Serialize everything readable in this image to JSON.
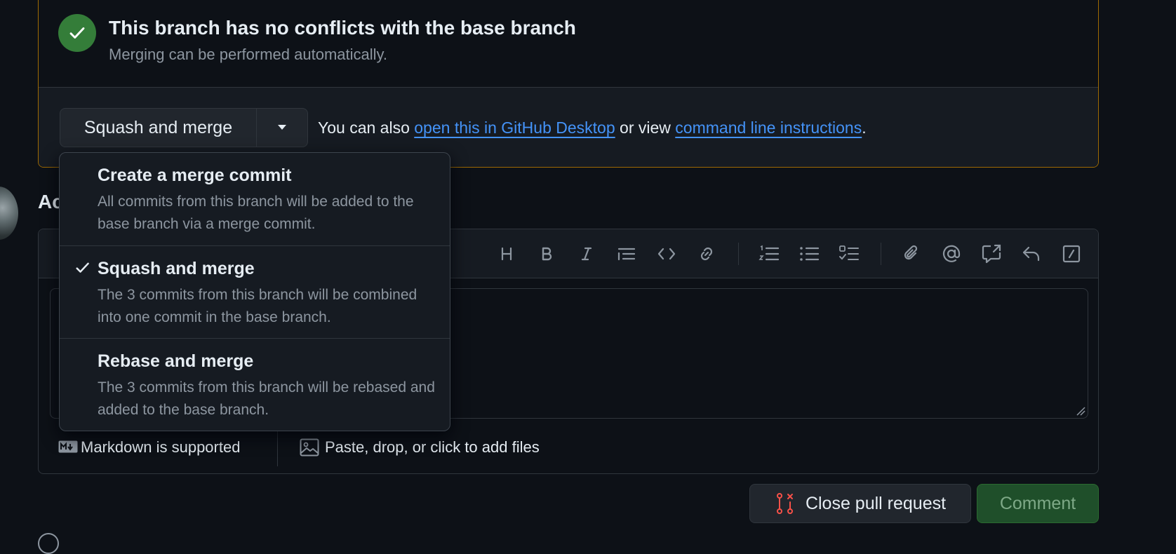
{
  "merge_status": {
    "title": "This branch has no conflicts with the base branch",
    "subtitle": "Merging can be performed automatically."
  },
  "merge_actions": {
    "merge_button_label": "Squash and merge",
    "also_prefix": "You can also ",
    "desktop_link": "open this in GitHub Desktop",
    "or_view": " or view ",
    "cli_link": "command line instructions",
    "period": "."
  },
  "merge_menu": {
    "items": [
      {
        "title": "Create a merge commit",
        "description": "All commits from this branch will be added to the base branch via a merge commit.",
        "selected": false
      },
      {
        "title": "Squash and merge",
        "description": "The 3 commits from this branch will be combined into one commit in the base branch.",
        "selected": true
      },
      {
        "title": "Rebase and merge",
        "description": "The 3 commits from this branch will be rebased and added to the base branch.",
        "selected": false
      }
    ]
  },
  "comment_section": {
    "heading_fragment": "Ac"
  },
  "toolbar": {
    "icons": [
      "heading-icon",
      "bold-icon",
      "italic-icon",
      "quote-icon",
      "code-icon",
      "link-icon",
      "ordered-list-icon",
      "unordered-list-icon",
      "task-list-icon",
      "attach-icon",
      "mention-icon",
      "cross-reference-icon",
      "reply-icon",
      "slash-command-icon"
    ]
  },
  "comment_footer": {
    "markdown_label": "Markdown is supported",
    "files_label": "Paste, drop, or click to add files"
  },
  "actions": {
    "close_label": "Close pull request",
    "comment_label": "Comment"
  },
  "colors": {
    "success": "#347d39",
    "link": "#4493f8",
    "warning_border": "#9e6a03",
    "danger": "#f85149"
  }
}
